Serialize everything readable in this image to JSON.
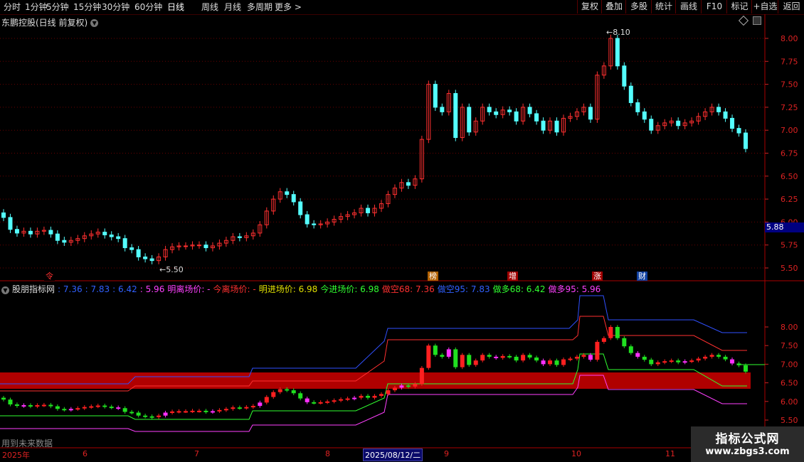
{
  "toolbar": {
    "periods": [
      "分时",
      "1分钟",
      "5分钟",
      "15分钟",
      "30分钟",
      "60分钟",
      "日线",
      "周线",
      "月线",
      "多周期",
      "更多 >"
    ],
    "active_period": "日线",
    "buttons": [
      "复权",
      "叠加",
      "多股",
      "统计",
      "画线",
      "F10",
      "标记",
      "+自选",
      "返回"
    ]
  },
  "stock_title": "东鹏控股(日线 前复权)",
  "price_axis": [
    "8.00",
    "7.75",
    "7.50",
    "7.25",
    "7.00",
    "6.75",
    "6.50",
    "6.25",
    "6.00",
    "5.75",
    "5.50"
  ],
  "current_price": "5.88",
  "high_label": "8.10",
  "low_label": "5.50",
  "markers": [
    {
      "text": "令",
      "color": "#ff3030",
      "bg": "#000"
    },
    {
      "text": "榜",
      "color": "#fff",
      "bg": "#b06000"
    },
    {
      "text": "增",
      "color": "#fff",
      "bg": "#a00000"
    },
    {
      "text": "涨",
      "color": "#fff",
      "bg": "#a00000"
    },
    {
      "text": "财",
      "color": "#fff",
      "bg": "#1040a0"
    }
  ],
  "indicator": {
    "name": "股朋指标网",
    "values_prefix": [
      {
        "text": ": 7.36",
        "color": "#3060ff"
      },
      {
        "text": ": 7.83",
        "color": "#3060ff"
      },
      {
        "text": ": 6.42",
        "color": "#3060ff"
      },
      {
        "text": ": 5.96",
        "color": "#ff40ff"
      }
    ],
    "items": [
      {
        "label": "明离场价:",
        "value": "-",
        "color": "#ff40ff"
      },
      {
        "label": "今离场价:",
        "value": "-",
        "color": "#ff3030"
      },
      {
        "label": "明进场价:",
        "value": "6.98",
        "color": "#e0e000"
      },
      {
        "label": "今进场价:",
        "value": "6.98",
        "color": "#30ff30"
      },
      {
        "label": "做空68:",
        "value": "7.36",
        "color": "#ff3030"
      },
      {
        "label": "做空95:",
        "value": "7.83",
        "color": "#3060ff"
      },
      {
        "label": "做多68:",
        "value": "6.42",
        "color": "#30ff30"
      },
      {
        "label": "做多95:",
        "value": "5.96",
        "color": "#ff40ff"
      }
    ],
    "axis": [
      "8.00",
      "7.50",
      "7.00",
      "6.50",
      "6.00",
      "5.50"
    ]
  },
  "future_note": "用到未来数据",
  "dates": [
    {
      "text": "2025年",
      "selected": false
    },
    {
      "text": "6",
      "selected": false
    },
    {
      "text": "7",
      "selected": false
    },
    {
      "text": "8",
      "selected": false
    },
    {
      "text": "2025/08/12/二",
      "selected": true
    },
    {
      "text": "9",
      "selected": false
    },
    {
      "text": "10",
      "selected": false
    },
    {
      "text": "11",
      "selected": false
    }
  ],
  "watermark": {
    "line1": "指标公式网",
    "line2": "www.zbgs3.com"
  },
  "colors": {
    "up": "#ff3030",
    "down": "#54ffff",
    "axis_red": "#d22",
    "grid": "#600"
  },
  "chart_data": {
    "type": "candlestick",
    "ohlc_close": [
      6.05,
      5.92,
      5.88,
      5.9,
      5.87,
      5.9,
      5.91,
      5.87,
      5.8,
      5.78,
      5.8,
      5.82,
      5.85,
      5.87,
      5.89,
      5.86,
      5.84,
      5.82,
      5.72,
      5.7,
      5.62,
      5.6,
      5.58,
      5.62,
      5.7,
      5.73,
      5.74,
      5.74,
      5.75,
      5.75,
      5.72,
      5.74,
      5.77,
      5.8,
      5.84,
      5.83,
      5.85,
      5.88,
      5.97,
      6.12,
      6.25,
      6.33,
      6.3,
      6.22,
      6.08,
      5.98,
      5.97,
      5.98,
      6.0,
      6.03,
      6.06,
      6.08,
      6.1,
      6.15,
      6.1,
      6.15,
      6.2,
      6.3,
      6.37,
      6.43,
      6.4,
      6.47,
      6.9,
      7.5,
      7.25,
      7.2,
      7.4,
      6.92,
      7.25,
      6.98,
      7.1,
      7.25,
      7.2,
      7.17,
      7.22,
      7.2,
      7.1,
      7.25,
      7.18,
      7.1,
      7.0,
      7.1,
      6.98,
      7.13,
      7.15,
      7.2,
      7.25,
      7.12,
      7.6,
      7.7,
      8.0,
      7.7,
      7.48,
      7.3,
      7.2,
      7.12,
      7.0,
      7.05,
      7.08,
      7.1,
      7.05,
      7.08,
      7.1,
      7.15,
      7.2,
      7.25,
      7.2,
      7.13,
      7.02,
      6.97,
      6.8
    ],
    "ylim": [
      5.45,
      8.15
    ]
  }
}
